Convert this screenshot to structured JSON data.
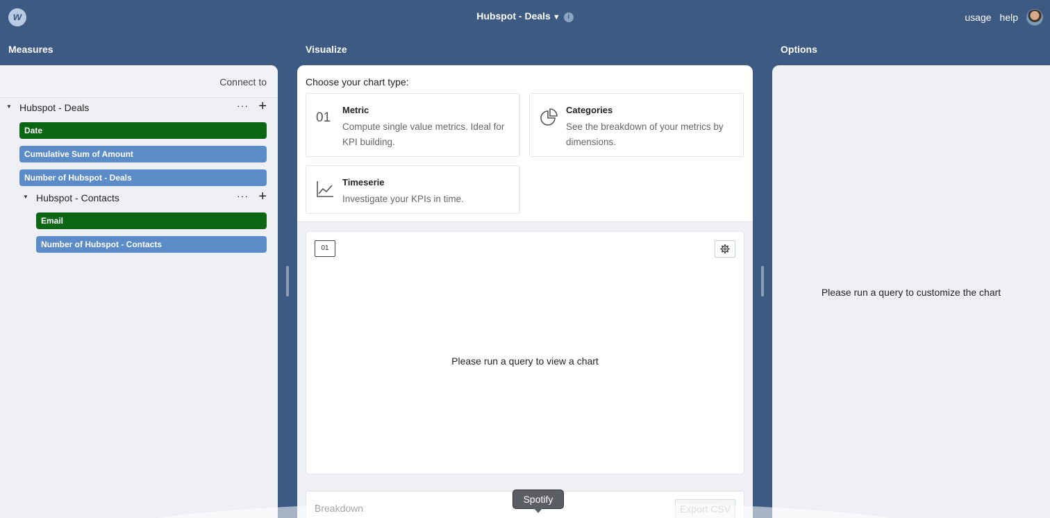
{
  "header": {
    "title": "Hubspot - Deals",
    "links": [
      "usage",
      "help"
    ]
  },
  "sections": {
    "measures": "Measures",
    "visualize": "Visualize",
    "options": "Options"
  },
  "measures": {
    "connect_label": "Connect to",
    "datasets": [
      {
        "name": "Hubspot - Deals",
        "fields": [
          {
            "label": "Date",
            "kind": "dimension",
            "color": "#0c6714"
          },
          {
            "label": "Cumulative Sum of Amount",
            "kind": "measure",
            "color": "#5b8cc7"
          },
          {
            "label": "Number of Hubspot - Deals",
            "kind": "measure",
            "color": "#5b8cc7"
          }
        ]
      },
      {
        "name": "Hubspot - Contacts",
        "fields": [
          {
            "label": "Email",
            "kind": "dimension",
            "color": "#0c6714"
          },
          {
            "label": "Number of Hubspot - Contacts",
            "kind": "measure",
            "color": "#5b8cc7"
          }
        ]
      }
    ],
    "more_icon": "ellipsis-icon",
    "add_icon": "plus-icon"
  },
  "visualize": {
    "choose_label": "Choose your chart type:",
    "chart_types": [
      {
        "icon_text": "01",
        "name": "Metric",
        "description": "Compute single value metrics. Ideal for KPI building."
      },
      {
        "icon": "pie-chart-icon",
        "name": "Categories",
        "description": "See the breakdown of your metrics by dimensions."
      },
      {
        "icon": "line-chart-icon",
        "name": "Timeserie",
        "description": "Investigate your KPIs in time."
      }
    ],
    "metric_badge": "01",
    "chart_placeholder": "Please run a query to view a chart",
    "breakdown_label": "Breakdown",
    "export_label": "Export CSV"
  },
  "options": {
    "placeholder": "Please run a query to customize the chart"
  },
  "tooltip": "Spotify"
}
